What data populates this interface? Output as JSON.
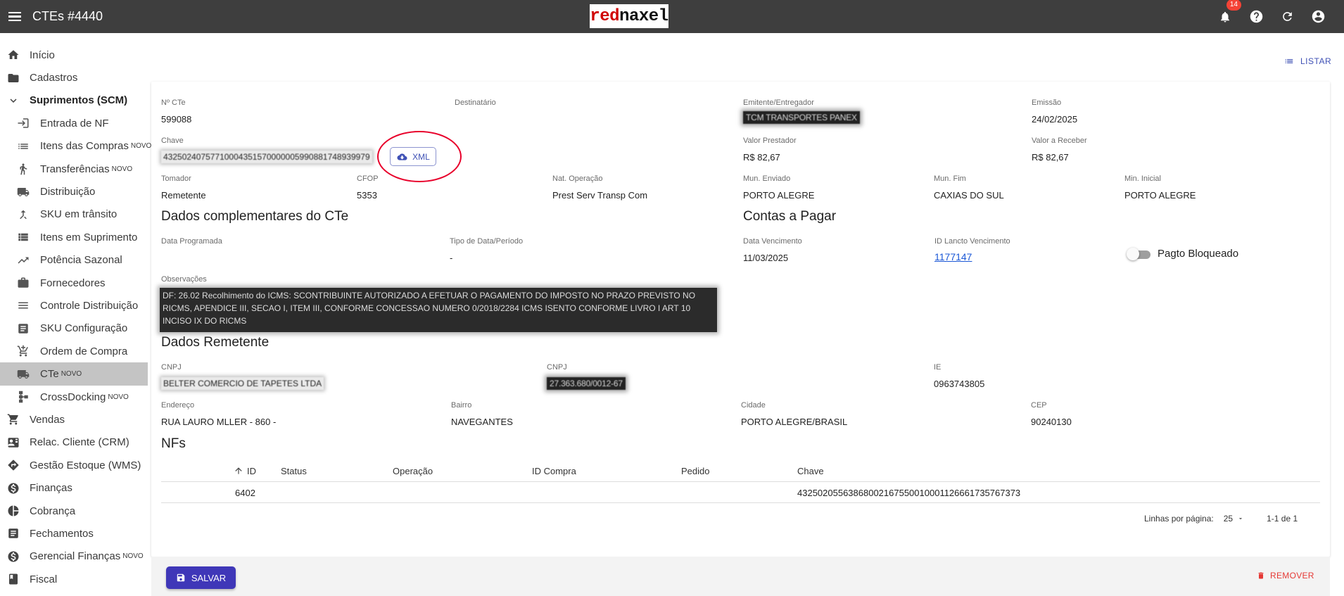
{
  "header": {
    "title": "CTEs #4440",
    "logo_part1": "red",
    "logo_part2": "naxel",
    "notifications_count": "14"
  },
  "sidebar": {
    "items": [
      {
        "label": "Início",
        "icon": "home-icon",
        "level": "top"
      },
      {
        "label": "Cadastros",
        "icon": "folder-icon",
        "level": "top"
      },
      {
        "label": "Suprimentos (SCM)",
        "icon": "chevron-down-icon",
        "level": "group"
      },
      {
        "label": "Entrada de NF",
        "icon": "login-icon",
        "level": "sub"
      },
      {
        "label": "Itens das Compras",
        "badge": "NOVO",
        "icon": "list-icon",
        "level": "sub"
      },
      {
        "label": "Transferências",
        "badge": "NOVO",
        "icon": "transfer-icon",
        "level": "sub"
      },
      {
        "label": "Distribuição",
        "icon": "truck-icon",
        "level": "sub"
      },
      {
        "label": "SKU em trânsito",
        "icon": "merge-icon",
        "level": "sub"
      },
      {
        "label": "Itens em Suprimento",
        "icon": "list-alt-icon",
        "level": "sub"
      },
      {
        "label": "Potência Sazonal",
        "icon": "trending-icon",
        "level": "sub"
      },
      {
        "label": "Fornecedores",
        "icon": "briefcase-icon",
        "level": "sub"
      },
      {
        "label": "Controle Distribuição",
        "icon": "menu-lines-icon",
        "level": "sub"
      },
      {
        "label": "SKU Configuração",
        "icon": "article-icon",
        "level": "sub"
      },
      {
        "label": "Ordem de Compra",
        "icon": "cart-add-icon",
        "level": "sub"
      },
      {
        "label": "CTe",
        "badge": "NOVO",
        "icon": "truck-icon",
        "level": "sub",
        "active": true
      },
      {
        "label": "CrossDocking",
        "badge": "NOVO",
        "icon": "schema-icon",
        "level": "sub"
      },
      {
        "label": "Vendas",
        "icon": "cart-icon",
        "level": "top"
      },
      {
        "label": "Relac. Cliente (CRM)",
        "icon": "contact-card-icon",
        "level": "top"
      },
      {
        "label": "Gestão Estoque (WMS)",
        "icon": "direction-icon",
        "level": "top"
      },
      {
        "label": "Finanças",
        "icon": "dollar-icon",
        "level": "top"
      },
      {
        "label": "Cobrança",
        "icon": "pie-icon",
        "level": "top"
      },
      {
        "label": "Fechamentos",
        "icon": "receipt-icon",
        "level": "top"
      },
      {
        "label": "Gerencial Finanças",
        "badge": "NOVO",
        "icon": "dollar-icon",
        "level": "top"
      },
      {
        "label": "Fiscal",
        "icon": "book-icon",
        "level": "top"
      }
    ]
  },
  "actions": {
    "listar": "LISTAR",
    "xml": "XML",
    "save": "SALVAR",
    "remove": "REMOVER"
  },
  "cte": {
    "numero_label": "Nº CTe",
    "numero": "599088",
    "destinatario_label": "Destinatário",
    "destinatario": "",
    "emitente_label": "Emitente/Entregador",
    "emitente": "TCM TRANSPORTES PANEX",
    "emissao_label": "Emissão",
    "emissao": "24/02/2025",
    "chave_label": "Chave",
    "chave": "43250240757710004351570000005990881748939979",
    "valor_prestador_label": "Valor Prestador",
    "valor_prestador": "R$ 82,67",
    "valor_receber_label": "Valor a Receber",
    "valor_receber": "R$ 82,67",
    "tomador_label": "Tomador",
    "tomador": "Remetente",
    "cfop_label": "CFOP",
    "cfop": "5353",
    "nat_operacao_label": "Nat. Operação",
    "nat_operacao": "Prest Serv Transp Com",
    "mun_enviado_label": "Mun. Enviado",
    "mun_enviado": "PORTO ALEGRE",
    "mun_fim_label": "Mun. Fim",
    "mun_fim": "CAXIAS DO SUL",
    "min_inicial_label": "Min. Inicial",
    "min_inicial": "PORTO ALEGRE"
  },
  "complementares": {
    "title": "Dados complementares do CTe",
    "data_programada_label": "Data Programada",
    "data_programada": "",
    "tipo_data_label": "Tipo de Data/Período",
    "tipo_data": "-",
    "observacoes_label": "Observações",
    "observacoes": "DF: 26.02 Recolhimento do ICMS: SCONTRIBUINTE AUTORIZADO A EFETUAR O PAGAMENTO DO IMPOSTO NO PRAZO PREVISTO NO RICMS, APENDICE III, SECAO I, ITEM III, CONFORME CONCESSAO NUMERO 0/2018/2284 ICMS ISENTO CONFORME LIVRO I ART 10 INCISO IX DO RICMS"
  },
  "contas": {
    "title": "Contas a Pagar",
    "data_vencimento_label": "Data Vencimento",
    "data_vencimento": "11/03/2025",
    "id_lancto_label": "ID Lancto Vencimento",
    "id_lancto": "1177147",
    "pagto_bloqueado_label": "Pagto Bloqueado"
  },
  "remetente": {
    "title": "Dados Remetente",
    "cnpj_label": "CNPJ",
    "cnpj": "BELTER COMERCIO DE TAPETES LTDA",
    "cnpj2_label": "CNPJ",
    "cnpj2": "27.363.680/0012-67",
    "ie_label": "IE",
    "ie": "0963743805",
    "endereco_label": "Endereço",
    "endereco": "RUA LAURO MLLER - 860 -",
    "bairro_label": "Bairro",
    "bairro": "NAVEGANTES",
    "cidade_label": "Cidade",
    "cidade": "PORTO ALEGRE/BRASIL",
    "cep_label": "CEP",
    "cep": "90240130"
  },
  "nfs": {
    "title": "NFs",
    "columns": [
      "ID",
      "Status",
      "Operação",
      "ID Compra",
      "Pedido",
      "Chave"
    ],
    "rows": [
      {
        "id": "6402",
        "status": "",
        "operacao": "",
        "id_compra": "",
        "pedido": "",
        "chave": "43250205563868002167550010001126661735767373"
      }
    ],
    "rows_per_page_label": "Linhas por página:",
    "rows_per_page": "25",
    "range": "1-1 de 1"
  }
}
